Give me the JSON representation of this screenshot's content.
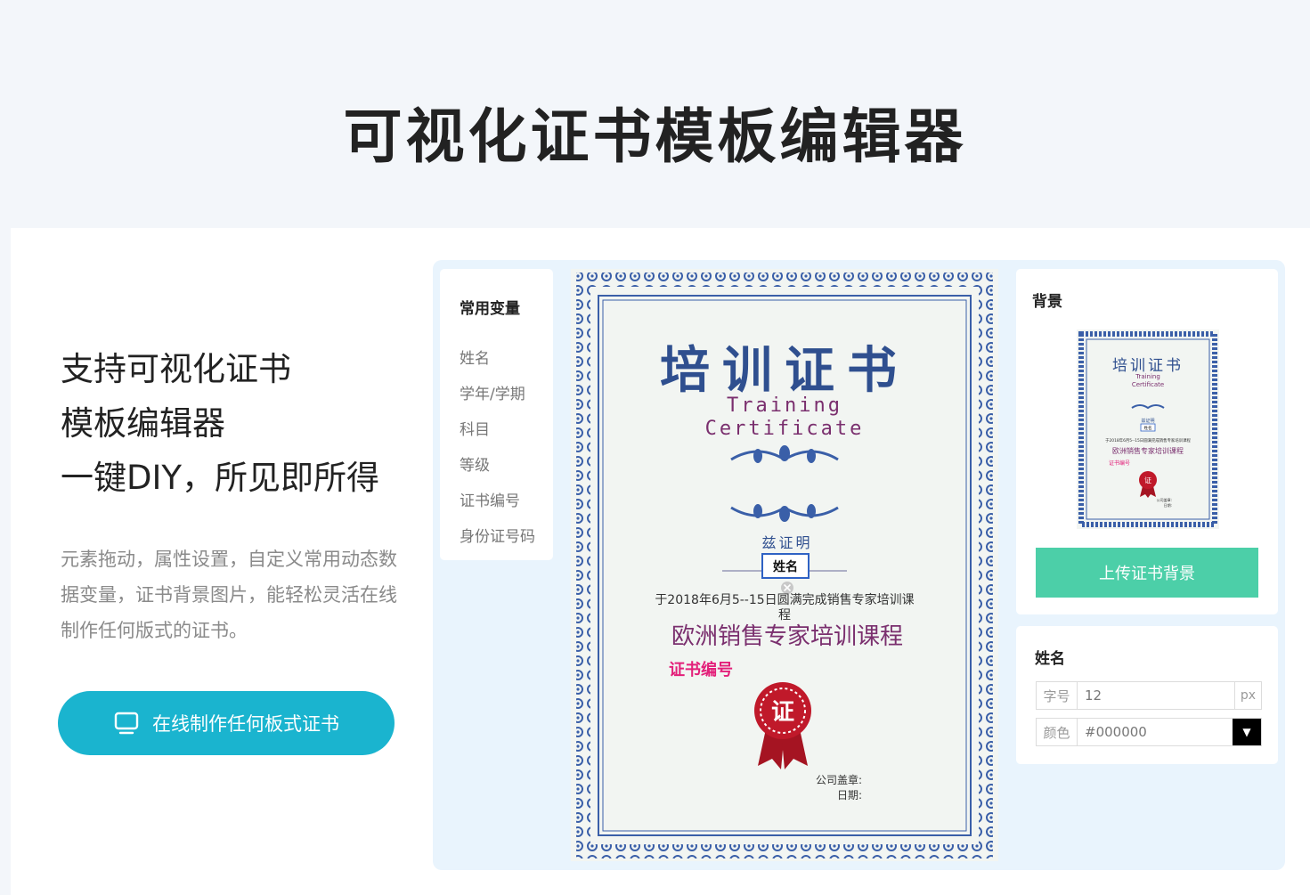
{
  "page": {
    "title": "可视化证书模板编辑器"
  },
  "hero": {
    "lines": [
      "支持可视化证书",
      "模板编辑器",
      "一键DIY，所见即所得"
    ],
    "description": "元素拖动，属性设置，自定义常用动态数据变量，证书背景图片，能轻松灵活在线制作任何版式的证书。",
    "cta_label": "在线制作任何板式证书"
  },
  "variables": {
    "title": "常用变量",
    "items": [
      "姓名",
      "学年/学期",
      "科目",
      "等级",
      "证书编号",
      "身份证号码"
    ]
  },
  "certificate": {
    "title_cn": "培训证书",
    "title_en_1": "Training",
    "title_en_2": "Certificate",
    "prefix": "兹证明",
    "name_placeholder": "姓名",
    "body_line": "于2018年6月5--15日圆满完成销售专家培训课",
    "body_wrap": "程",
    "course": "欧洲销售专家培训课程",
    "cert_no": "证书编号",
    "seal": "证",
    "stamp_label": "公司盖章:",
    "date_label": "日期:"
  },
  "background_panel": {
    "title": "背景",
    "upload_label": "上传证书背景",
    "thumb_title_cn": "培训证书",
    "thumb_title_en_1": "Training",
    "thumb_title_en_2": "Certificate",
    "thumb_prefix": "兹证明",
    "thumb_name": "姓名",
    "thumb_body": "于2018年6月5--15日圆满完成销售专家培训课程",
    "thumb_course": "欧洲销售专家培训课程",
    "thumb_cert_no": "证书编号",
    "thumb_seal": "证",
    "thumb_stamp": "公司盖章:",
    "thumb_date": "日期:"
  },
  "property_panel": {
    "title": "姓名",
    "font_size_label": "字号",
    "font_size_value": "12",
    "font_size_unit": "px",
    "color_label": "颜色",
    "color_value": "#000000"
  },
  "colors": {
    "accent": "#1ab4cf",
    "upload": "#4ccfa8",
    "cert_blue": "#2f4f8f",
    "cert_purple": "#7a2f6e",
    "cert_pink": "#e3207a",
    "seal_red": "#c0192a"
  }
}
